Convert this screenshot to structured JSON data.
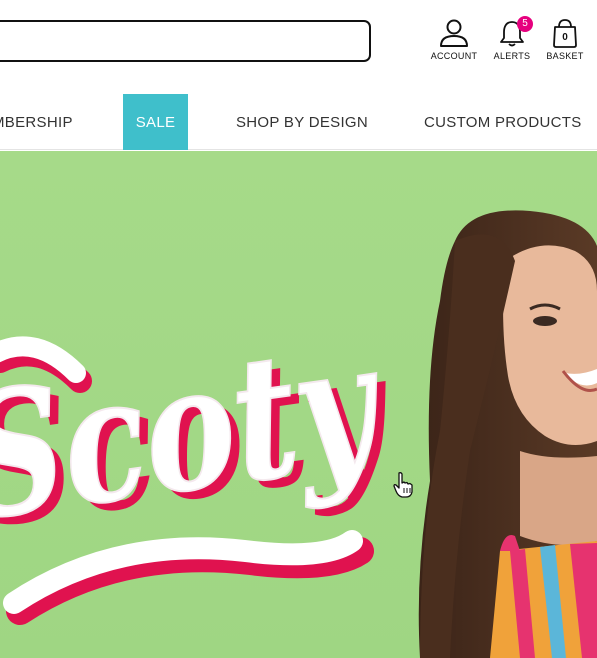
{
  "header": {
    "search": {
      "value": "",
      "placeholder": ""
    },
    "account": {
      "label": "ACCOUNT",
      "icon": "person-icon"
    },
    "alerts": {
      "label": "ALERTS",
      "icon": "bell-icon",
      "count": "5"
    },
    "basket": {
      "label": "BASKET",
      "icon": "shopping-bag-icon",
      "count": "0"
    }
  },
  "nav": {
    "items": [
      {
        "label": "MBERSHIP"
      },
      {
        "label": "SALE",
        "highlight": "#3fbfcb"
      },
      {
        "label": "SHOP BY DESIGN"
      },
      {
        "label": "CUSTOM PRODUCTS"
      }
    ]
  },
  "hero": {
    "script_text": "Scoty",
    "background": "#a4d987",
    "text_fill": "#ffffff",
    "text_shadow": "#e0124f"
  },
  "colors": {
    "accent": "#3fbfcb",
    "badge": "#e6007e"
  }
}
